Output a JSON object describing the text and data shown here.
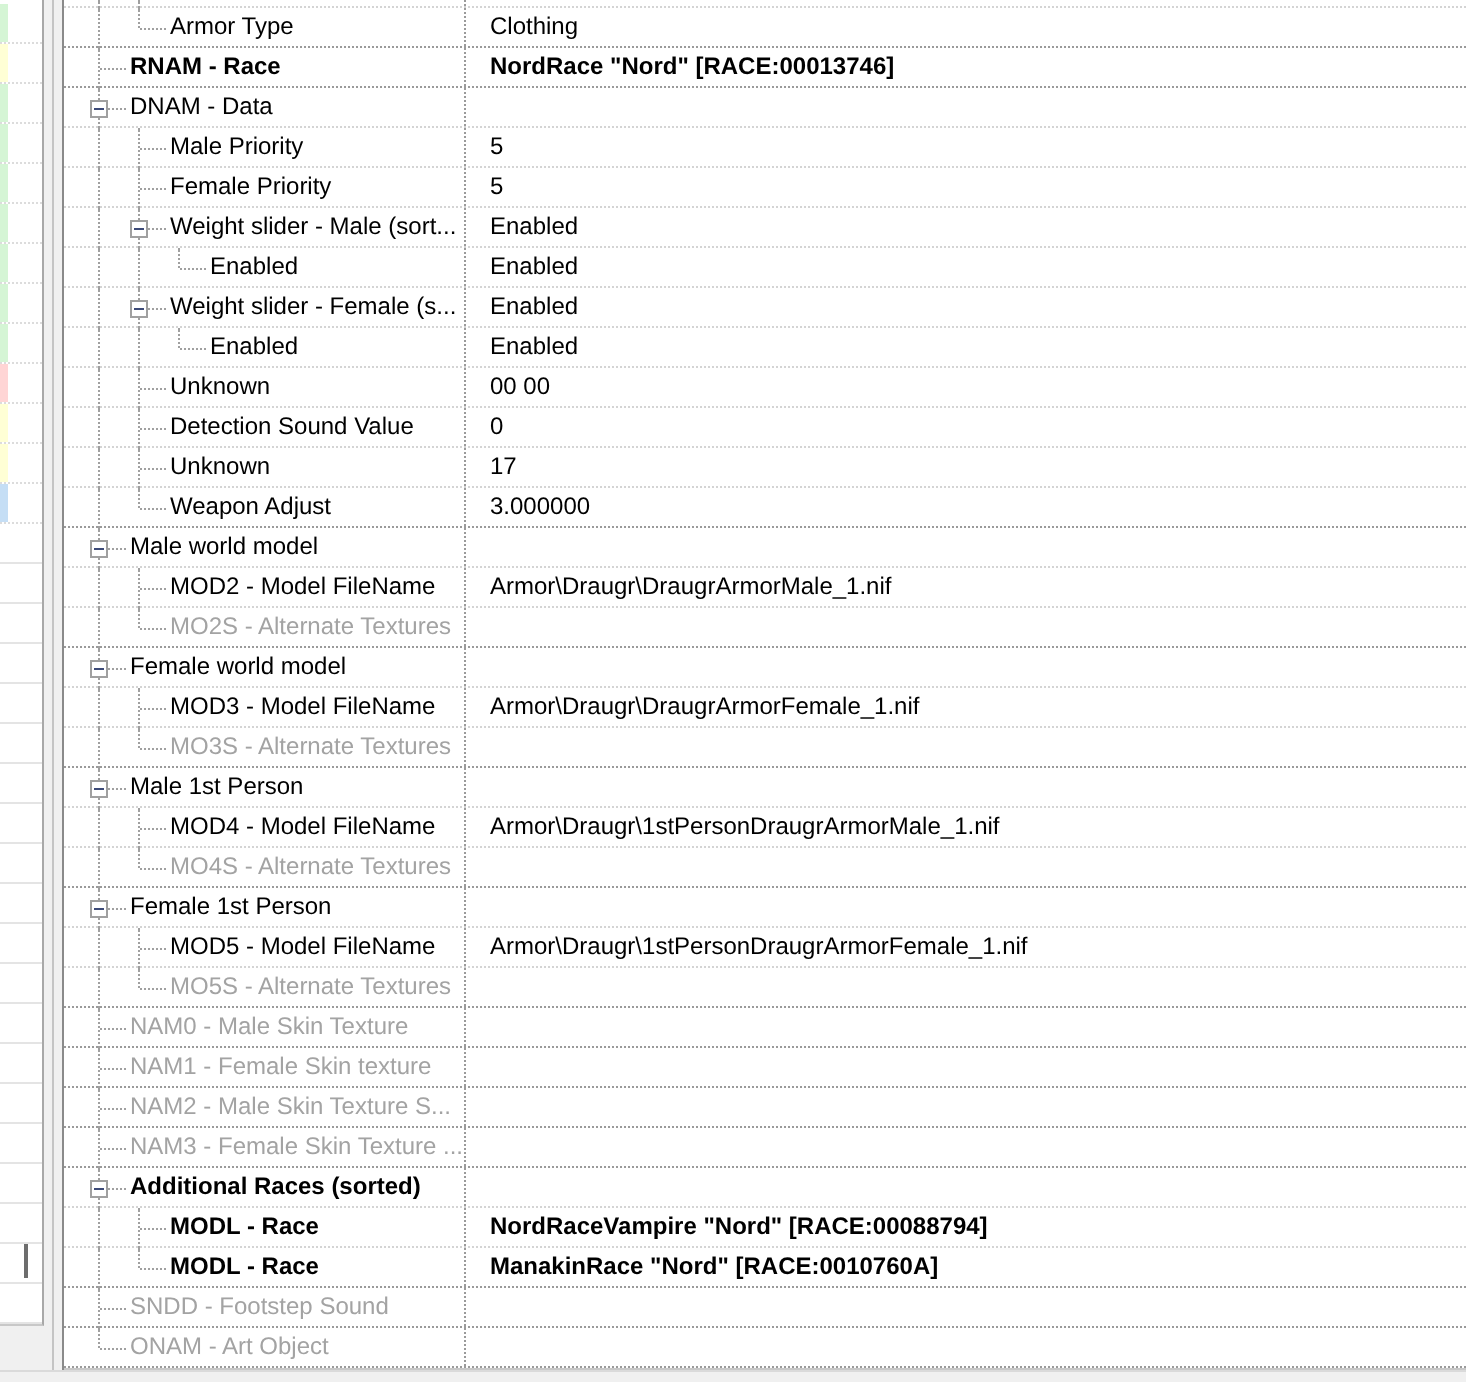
{
  "record_list": {
    "rows": [
      {
        "color": "#d5f5d5"
      },
      {
        "color": "#ffffd5"
      },
      {
        "color": "#d5f5d5"
      },
      {
        "color": "#d5f5d5"
      },
      {
        "color": "#d5f5d5"
      },
      {
        "color": "#d5f5d5"
      },
      {
        "color": "#d5f5d5"
      },
      {
        "color": "#d5f5d5"
      },
      {
        "color": "#d5f5d5"
      },
      {
        "color": "#ffd5d5"
      },
      {
        "color": "#ffffd5"
      },
      {
        "color": "#ffffd5"
      },
      {
        "color": "#c5def5"
      }
    ]
  },
  "tree": {
    "items": [
      {
        "kind": "continued",
        "children": [
          {
            "name": "Armor Type",
            "value": "Clothing",
            "bold": false,
            "disabled": false
          }
        ]
      },
      {
        "kind": "node",
        "name": "RNAM - Race",
        "value": "NordRace \"Nord\" [RACE:00013746]",
        "bold": true,
        "disabled": false
      },
      {
        "kind": "node",
        "name": "DNAM - Data",
        "expanded": true,
        "bold": false,
        "disabled": false,
        "children": [
          {
            "name": "Male Priority",
            "value": "5",
            "bold": false,
            "disabled": false
          },
          {
            "name": "Female Priority",
            "value": "5",
            "bold": false,
            "disabled": false
          },
          {
            "name": "Weight slider - Male (sort...",
            "value": "Enabled",
            "expanded": true,
            "bold": false,
            "disabled": false,
            "children": [
              {
                "name": "Enabled",
                "value": "Enabled",
                "bold": false,
                "disabled": false
              }
            ]
          },
          {
            "name": "Weight slider - Female (s...",
            "value": "Enabled",
            "expanded": true,
            "bold": false,
            "disabled": false,
            "children": [
              {
                "name": "Enabled",
                "value": "Enabled",
                "bold": false,
                "disabled": false
              }
            ]
          },
          {
            "name": "Unknown",
            "value": "00 00",
            "bold": false,
            "disabled": false
          },
          {
            "name": "Detection Sound Value",
            "value": "0",
            "bold": false,
            "disabled": false
          },
          {
            "name": "Unknown",
            "value": "17",
            "bold": false,
            "disabled": false
          },
          {
            "name": "Weapon Adjust",
            "value": "3.000000",
            "bold": false,
            "disabled": false
          }
        ]
      },
      {
        "kind": "node",
        "name": "Male world model",
        "expanded": true,
        "bold": false,
        "disabled": false,
        "children": [
          {
            "name": "MOD2 - Model FileName",
            "value": "Armor\\Draugr\\DraugrArmorMale_1.nif",
            "bold": false,
            "disabled": false
          },
          {
            "name": "MO2S - Alternate Textures",
            "bold": false,
            "disabled": true
          }
        ]
      },
      {
        "kind": "node",
        "name": "Female world model",
        "expanded": true,
        "bold": false,
        "disabled": false,
        "children": [
          {
            "name": "MOD3 - Model FileName",
            "value": "Armor\\Draugr\\DraugrArmorFemale_1.nif",
            "bold": false,
            "disabled": false
          },
          {
            "name": "MO3S - Alternate Textures",
            "bold": false,
            "disabled": true
          }
        ]
      },
      {
        "kind": "node",
        "name": "Male 1st Person",
        "expanded": true,
        "bold": false,
        "disabled": false,
        "children": [
          {
            "name": "MOD4 - Model FileName",
            "value": "Armor\\Draugr\\1stPersonDraugrArmorMale_1.nif",
            "bold": false,
            "disabled": false
          },
          {
            "name": "MO4S - Alternate Textures",
            "bold": false,
            "disabled": true
          }
        ]
      },
      {
        "kind": "node",
        "name": "Female 1st Person",
        "expanded": true,
        "bold": false,
        "disabled": false,
        "children": [
          {
            "name": "MOD5 - Model FileName",
            "value": "Armor\\Draugr\\1stPersonDraugrArmorFemale_1.nif",
            "bold": false,
            "disabled": false
          },
          {
            "name": "MO5S - Alternate Textures",
            "bold": false,
            "disabled": true
          }
        ]
      },
      {
        "kind": "node",
        "name": "NAM0 - Male Skin Texture",
        "bold": false,
        "disabled": true
      },
      {
        "kind": "node",
        "name": "NAM1 - Female Skin texture",
        "bold": false,
        "disabled": true
      },
      {
        "kind": "node",
        "name": "NAM2 - Male Skin Texture S...",
        "bold": false,
        "disabled": true
      },
      {
        "kind": "node",
        "name": "NAM3 - Female Skin Texture ...",
        "bold": false,
        "disabled": true
      },
      {
        "kind": "node",
        "name": "Additional Races (sorted)",
        "expanded": true,
        "bold": true,
        "disabled": false,
        "children": [
          {
            "name": "MODL - Race",
            "value": "NordRaceVampire \"Nord\" [RACE:00088794]",
            "bold": true,
            "disabled": false
          },
          {
            "name": "MODL - Race",
            "value": "ManakinRace \"Nord\" [RACE:0010760A]",
            "bold": true,
            "disabled": false
          }
        ]
      },
      {
        "kind": "node",
        "name": "SNDD - Footstep Sound",
        "bold": false,
        "disabled": true
      },
      {
        "kind": "node",
        "name": "ONAM - Art Object",
        "bold": false,
        "disabled": true
      }
    ]
  }
}
